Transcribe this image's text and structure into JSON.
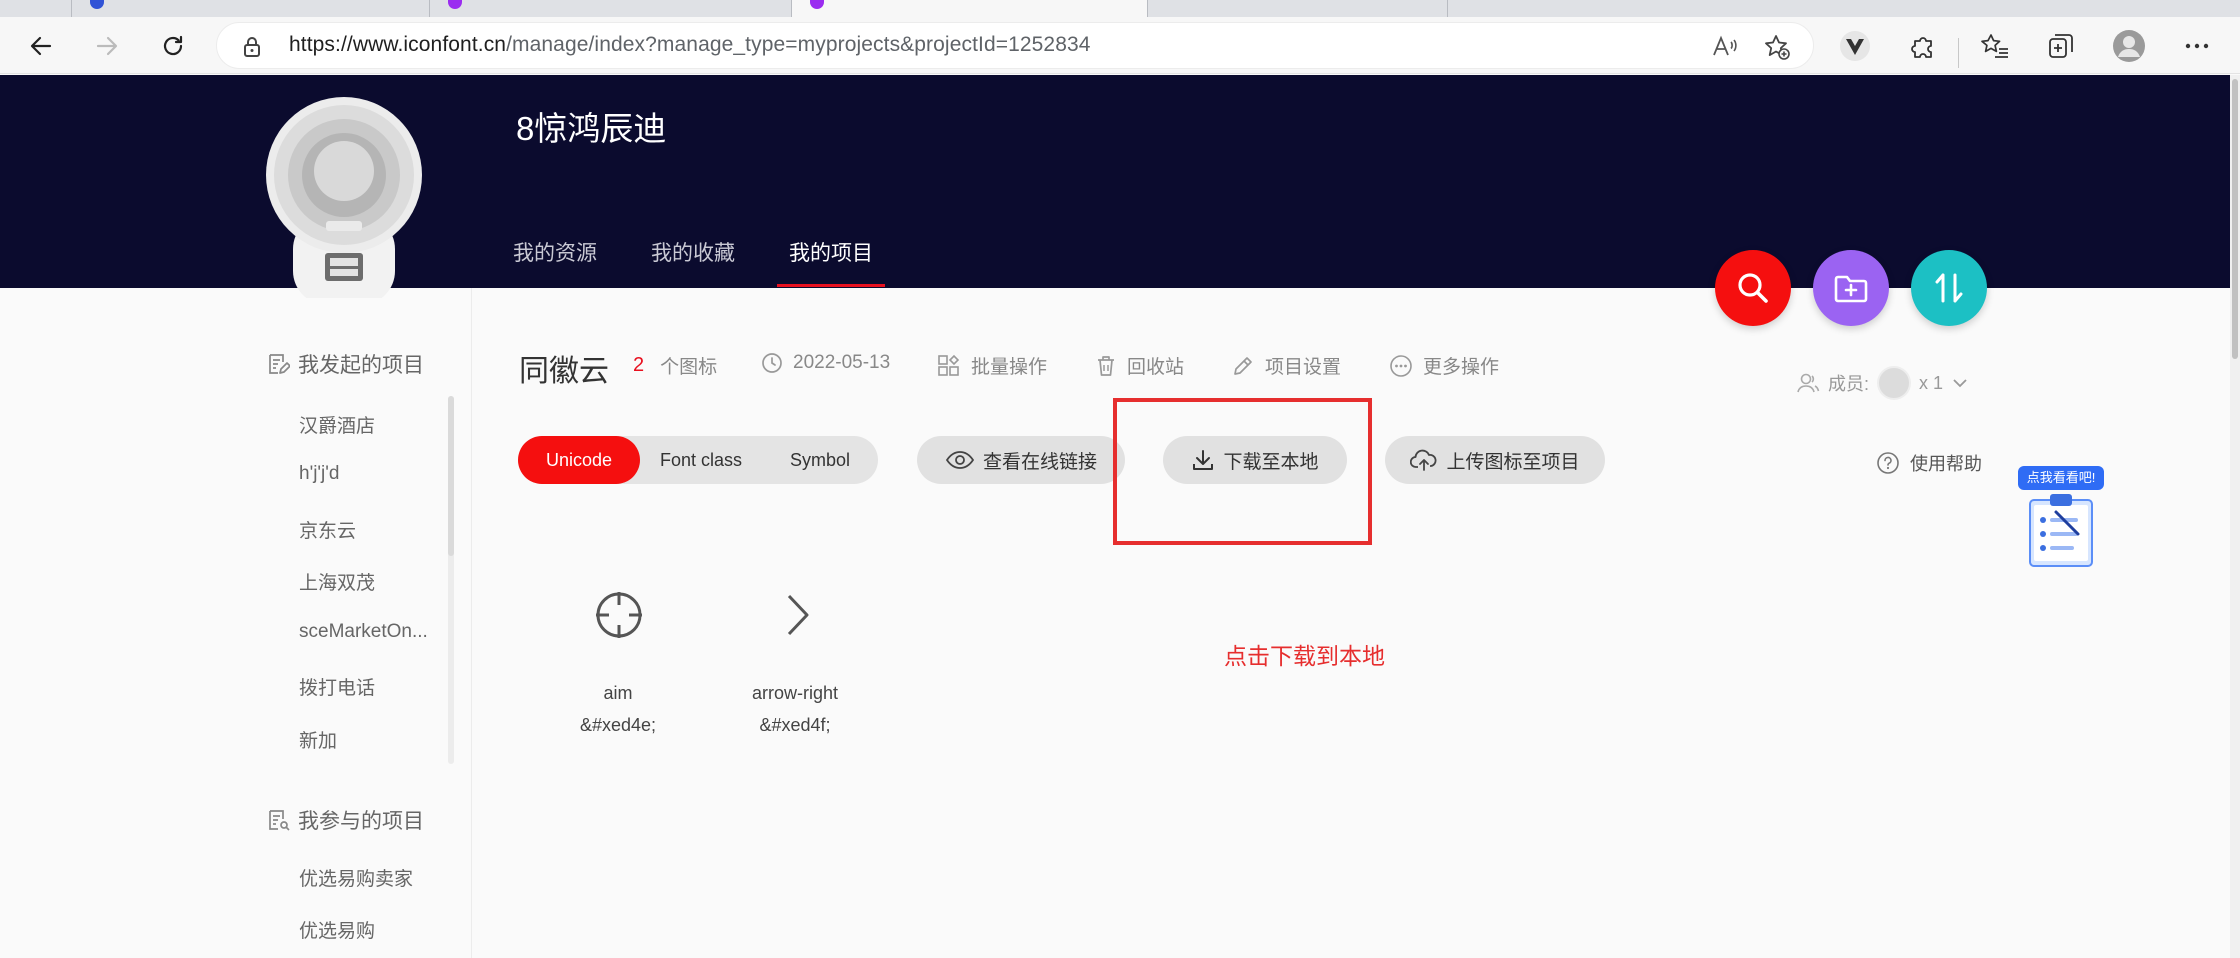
{
  "browser": {
    "url_host": "https://www.iconfont.cn",
    "url_path": "/manage/index?manage_type=myprojects&projectId=1252834"
  },
  "header": {
    "owner_name": "8惊鸿辰迪",
    "nav": [
      "我的资源",
      "我的收藏",
      "我的项目"
    ],
    "active_nav": "我的项目"
  },
  "sidebar": {
    "my_projects_title": "我发起的项目",
    "my_projects": [
      "汉爵酒店",
      "h'j'j'd",
      "京东云",
      "上海双茂",
      "sceMarketOn...",
      "拨打电话",
      "新加"
    ],
    "joined_projects_title": "我参与的项目",
    "joined_projects": [
      "优选易购卖家",
      "优选易购"
    ]
  },
  "project": {
    "title": "同徽云",
    "icon_count": "2",
    "icon_count_unit": "个图标",
    "date": "2022-05-13",
    "actions": [
      "批量操作",
      "回收站",
      "项目设置",
      "更多操作"
    ],
    "members_label": "成员:",
    "members_count": "x 1"
  },
  "toolbar": {
    "formats": [
      "Unicode",
      "Font class",
      "Symbol"
    ],
    "active_format": "Unicode",
    "view_online": "查看在线链接",
    "download": "下载至本地",
    "upload": "上传图标至项目",
    "help": "使用帮助"
  },
  "icons": [
    {
      "name": "aim",
      "code": "&#xed4e;",
      "icon": "aim-icon"
    },
    {
      "name": "arrow-right",
      "code": "&#xed4f;",
      "icon": "arrow-right-icon"
    }
  ],
  "annotation": "点击下载到本地",
  "helper_bubble": "点我看看吧!",
  "colors": {
    "header_bg": "#0b0b2e",
    "accent_red": "#f50f0f",
    "fab_search": "#f50f0f",
    "fab_folder": "#9b63f2",
    "fab_sort": "#1cc0c4",
    "annotation": "#e62e2e"
  }
}
